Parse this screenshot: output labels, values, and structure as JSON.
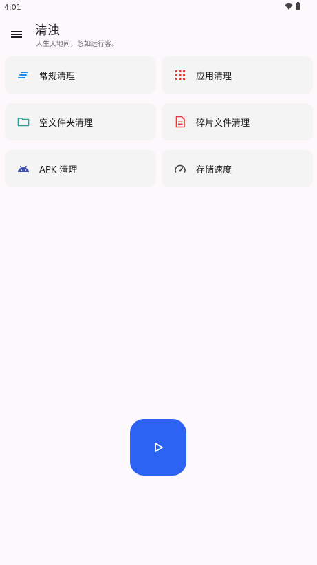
{
  "status_bar": {
    "time": "4:01",
    "icons": [
      "wifi-icon",
      "battery-icon"
    ]
  },
  "app_bar": {
    "title": "清浊",
    "subtitle": "人生天地间，忽如远行客。",
    "menu_icon": "menu-icon"
  },
  "cards": [
    {
      "label": "常规清理",
      "icon": "lines-icon",
      "icon_color": "#1e88e5"
    },
    {
      "label": "应用清理",
      "icon": "apps-grid-icon",
      "icon_color": "#e53935"
    },
    {
      "label": "空文件夹清理",
      "icon": "folder-icon",
      "icon_color": "#26a69a"
    },
    {
      "label": "碎片文件清理",
      "icon": "document-icon",
      "icon_color": "#e53935"
    },
    {
      "label": "APK 清理",
      "icon": "android-icon",
      "icon_color": "#3f51b5"
    },
    {
      "label": "存储速度",
      "icon": "speedometer-icon",
      "icon_color": "#444444"
    }
  ],
  "fab": {
    "icon": "play-icon",
    "color": "#2d63f2"
  }
}
